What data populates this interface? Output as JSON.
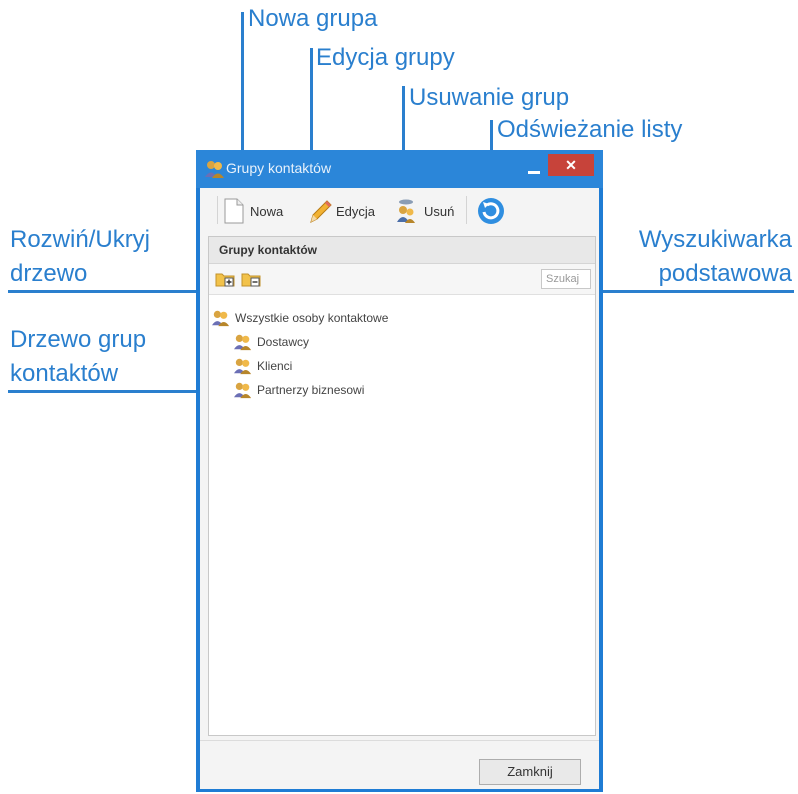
{
  "annotations": {
    "new_group": "Nowa grupa",
    "edit_group": "Edycja grupy",
    "delete_groups": "Usuwanie grup",
    "refresh_list": "Odświeżanie listy",
    "expand_collapse_line1": "Rozwiń/Ukryj",
    "expand_collapse_line2": "drzewo",
    "group_tree_line1": "Drzewo grup",
    "group_tree_line2": "kontaktów",
    "search_line1": "Wyszukiwarka",
    "search_line2": "podstawowa"
  },
  "window": {
    "title": "Grupy kontaktów",
    "close_symbol": "✕",
    "toolbar": {
      "new_label": "Nowa",
      "edit_label": "Edycja",
      "delete_label": "Usuń"
    },
    "panel": {
      "title": "Grupy kontaktów",
      "search_placeholder": "Szukaj"
    },
    "tree": {
      "root": "Wszystkie osoby kontaktowe",
      "children": [
        "Dostawcy",
        "Klienci",
        "Partnerzy biznesowi"
      ]
    },
    "footer": {
      "close_label": "Zamknij"
    }
  },
  "colors": {
    "callout": "#2a7fce",
    "window_frame": "#1f7cd4",
    "close_button": "#c7433a"
  },
  "icons": [
    "folder-expand-icon",
    "folder-collapse-icon",
    "contact-group-icon",
    "new-document-icon",
    "pencil-icon",
    "delete-group-icon",
    "refresh-icon"
  ]
}
